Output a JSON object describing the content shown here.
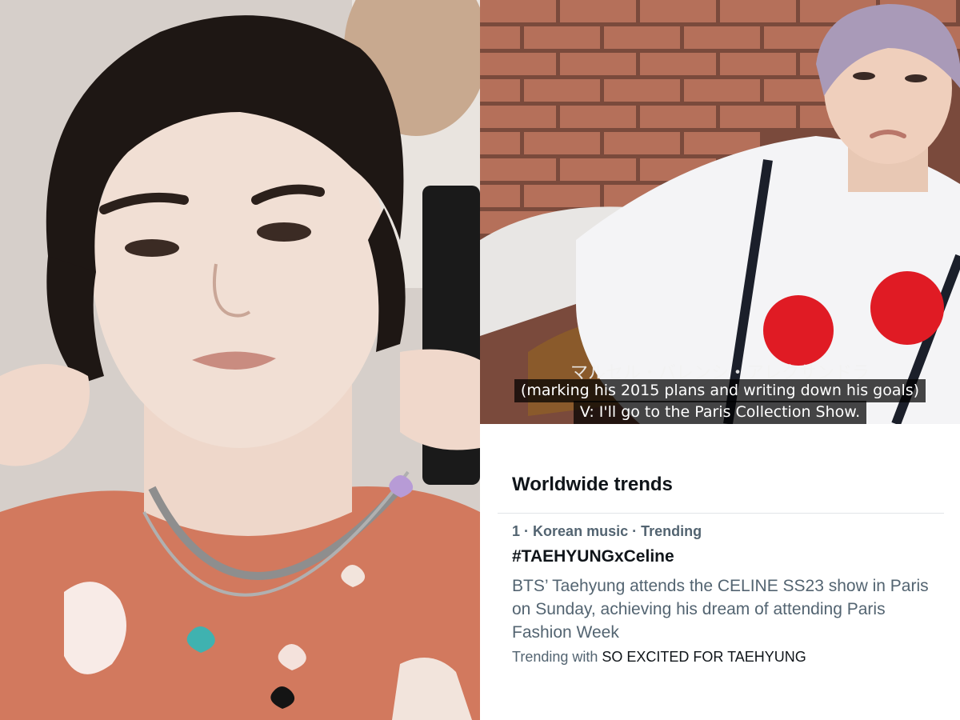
{
  "left_photo": {
    "name": "portrait-photo"
  },
  "video_frame": {
    "subtitle_japanese": "マルセル・バレンシ・アレクサンドラ",
    "subtitle_line_1": "(marking his 2015 plans and writing down his goals)",
    "subtitle_line_2": "V: I'll go to the Paris Collection Show."
  },
  "trends": {
    "heading": "Worldwide trends",
    "items": [
      {
        "rank": "1",
        "separator": "·",
        "category": "Korean music",
        "status": "Trending",
        "name": "#TAEHYUNGxCeline",
        "description": "BTS’ Taehyung attends the CELINE SS23 show in Paris on Sunday, achieving his dream of attending Paris Fashion Week",
        "trending_with_label": "Trending with",
        "trending_with_topic": "SO EXCITED FOR TAEHYUNG"
      }
    ]
  },
  "colors": {
    "text_primary": "#0f1419",
    "text_secondary": "#536471",
    "divider": "#e1e5e8",
    "shirt_dots": "#e01b24"
  }
}
